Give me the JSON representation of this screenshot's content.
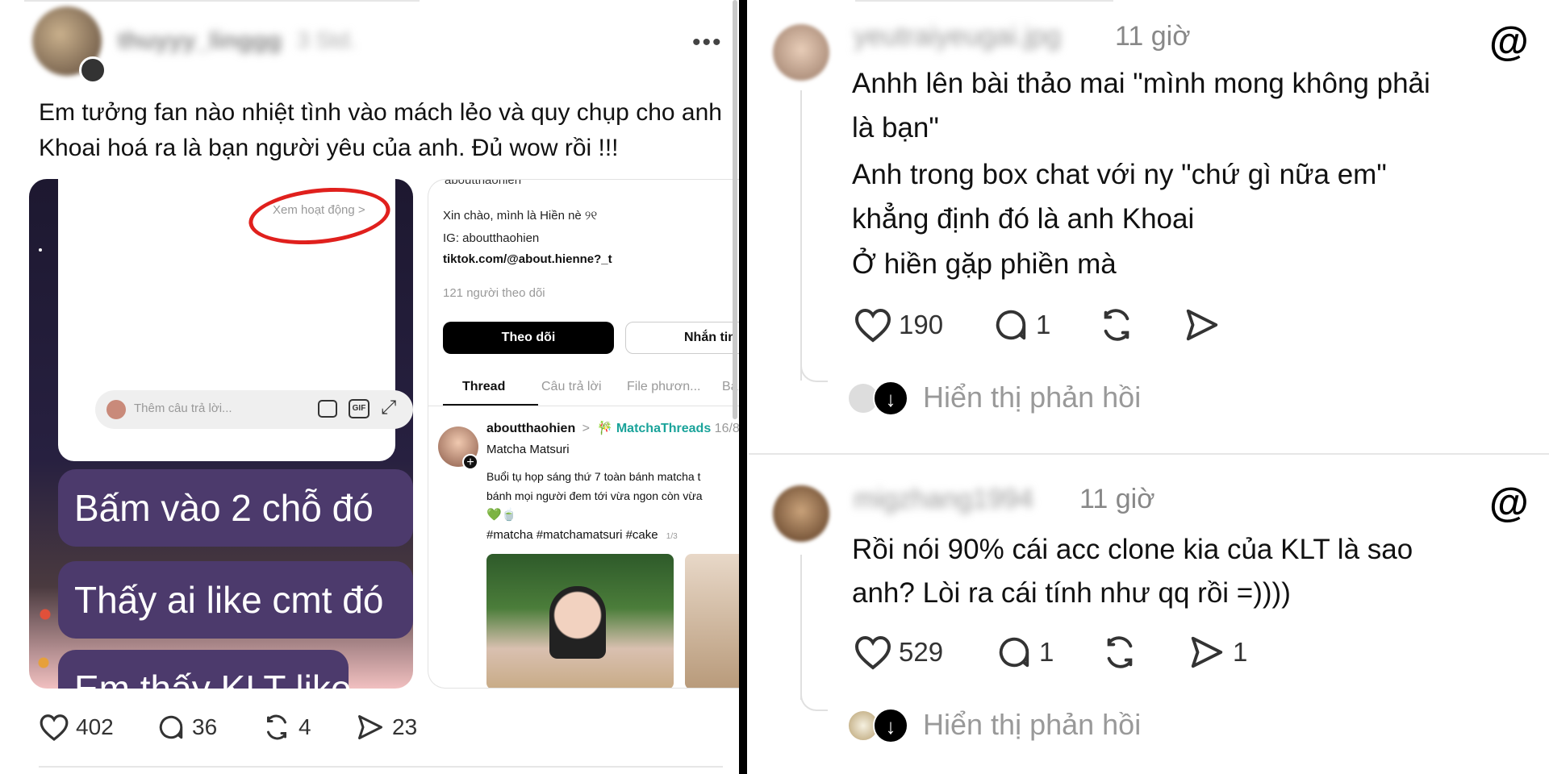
{
  "left_post": {
    "username": "thuyyy_linggg",
    "time": "3 Std.",
    "more": "•••",
    "text": "Em tưởng fan nào nhiệt tình vào mách lẻo và quy chụp cho anh Khoai hoá ra là bạn người yêu của anh. Đủ wow rồi !!!",
    "shot1": {
      "activity_link": "Xem hoạt động >",
      "reply_placeholder": "Thêm câu trả lời...",
      "gif": "GIF",
      "bubble1": "Bấm vào 2 chỗ đó",
      "bubble2": "Thấy ai like cmt đó",
      "bubble3": "Em thấy KLT like"
    },
    "shot2": {
      "handle_top": "aboutthaohien",
      "bio1": "Xin chào, mình là Hiền nè ୨୧",
      "bio2": "IG: aboutthaohien",
      "bio3": "tiktok.com/@about.hienne?_t",
      "followers": "121 người theo dõi",
      "follow_btn": "Theo dõi",
      "message_btn": "Nhắn tin",
      "tabs": [
        "Thread",
        "Câu trả lời",
        "File phươn...",
        "Bà"
      ],
      "post_user": "aboutthaohien",
      "post_arrow": ">",
      "community": "MatchaThreads",
      "post_date": "16/8",
      "post_title": "Matcha Matsuri",
      "post_body1": "Buổi tụ họp sáng thứ 7 toàn bánh matcha t",
      "post_body2": "bánh mọi người đem tới vừa ngon còn vừa",
      "post_tags": "#matcha #matchamatsuri #cake",
      "page_indicator": "1/3"
    },
    "stats": {
      "likes": "402",
      "comments": "36",
      "reposts": "4",
      "shares": "23"
    }
  },
  "comment1": {
    "username": "yeutraiyeugai.jpg",
    "time": "11 giờ",
    "lines": [
      "Anhh lên bài thảo mai \"mình mong không phải",
      "là bạn\"",
      "Anh trong box chat với ny \"chứ gì nữa em\"",
      "khẳng định đó là anh Khoai",
      "Ở hiền gặp phiền mà"
    ],
    "likes": "190",
    "comments": "1",
    "show_replies": "Hiển thị phản hồi"
  },
  "comment2": {
    "username": "migzhang1994",
    "time": "11 giờ",
    "lines": [
      "Rồi nói 90% cái acc clone kia của KLT là sao",
      "anh? Lòi ra cái tính như qq rồi =))))"
    ],
    "likes": "529",
    "comments": "1",
    "shares": "1",
    "show_replies": "Hiển thị phản hồi"
  },
  "colors": {
    "accent_teal": "#1aa39a",
    "bubble_purple": "#4c3a6c",
    "circle_red": "#e0201d"
  }
}
